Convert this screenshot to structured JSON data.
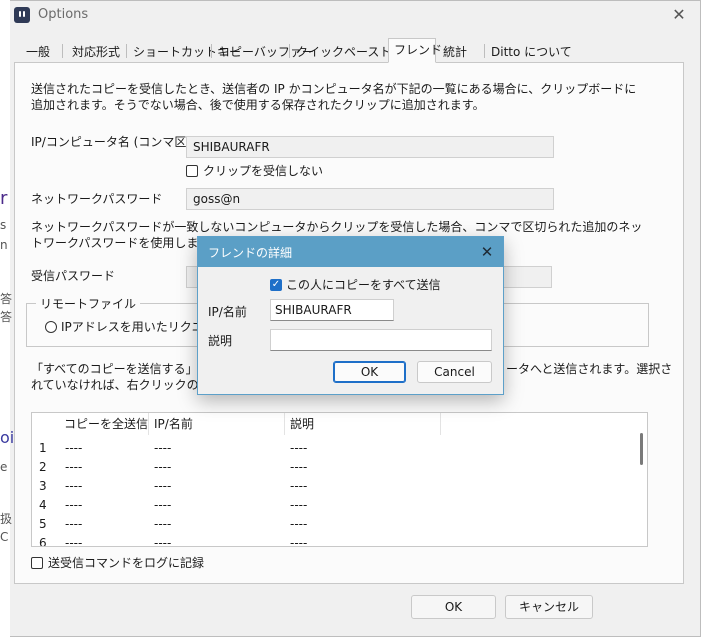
{
  "window": {
    "title": "Options"
  },
  "tabs": [
    "一般",
    "対応形式",
    "ショートカットキー",
    "コピーバッファー",
    "クイックペーストキー",
    "フレンド",
    "統計",
    "Ditto について"
  ],
  "friend_page": {
    "description": "送信されたコピーを受信したとき、送信者の IP かコンピュータ名が下記の一覧にある場合に、クリップボードに追加されます。そうでない場合、後で使用する保存されたクリップに追加されます。",
    "ip_label": "IP/コンピュータ名 (コンマ区切り)",
    "ip_value": "SHIBAURAFR",
    "dont_receive_label": "クリップを受信しない",
    "network_password_label": "ネットワークパスワード",
    "network_password_value": "goss@n",
    "extra_password_note": "ネットワークパスワードが一致しないコンピュータからクリップを受信した場合、コンマで区切られた追加のネットワークパスワードを使用します。",
    "receive_password_label": "受信パスワード",
    "remote_file_group": "リモートファイル",
    "remote_file_option": "IPアドレスを用いたリクエスト",
    "send_all_note_left_1": "「すべてのコピーを送信する」が選択",
    "send_all_note_right_1": "ータへと送信されます。選択さ",
    "send_all_note_left_2": "れていなければ、右クリックのメニュー",
    "list": {
      "columns": [
        "コピーを全送信",
        "IP/名前",
        "説明"
      ],
      "rows": [
        {
          "num": "1",
          "c1": "----",
          "c2": "----",
          "c3": "----"
        },
        {
          "num": "2",
          "c1": "----",
          "c2": "----",
          "c3": "----"
        },
        {
          "num": "3",
          "c1": "----",
          "c2": "----",
          "c3": "----"
        },
        {
          "num": "4",
          "c1": "----",
          "c2": "----",
          "c3": "----"
        },
        {
          "num": "5",
          "c1": "----",
          "c2": "----",
          "c3": "----"
        },
        {
          "num": "6",
          "c1": "----",
          "c2": "----",
          "c3": "----"
        }
      ]
    },
    "log_label": "送受信コマンドをログに記録"
  },
  "footer": {
    "ok": "OK",
    "cancel": "キャンセル"
  },
  "modal": {
    "title": "フレンドの詳細",
    "send_all_label": "この人にコピーをすべて送信",
    "ip_label": "IP/名前",
    "ip_value": "SHIBAURAFR",
    "desc_label": "説明",
    "desc_value": "",
    "ok": "OK",
    "cancel": "Cancel"
  },
  "background_fragments": [
    "r",
    "s",
    "n",
    "答",
    "答",
    "oi",
    "e",
    "扱",
    "C"
  ],
  "colors": {
    "modal_titlebar": "#5b9fc6",
    "accent": "#1e6fc8"
  }
}
